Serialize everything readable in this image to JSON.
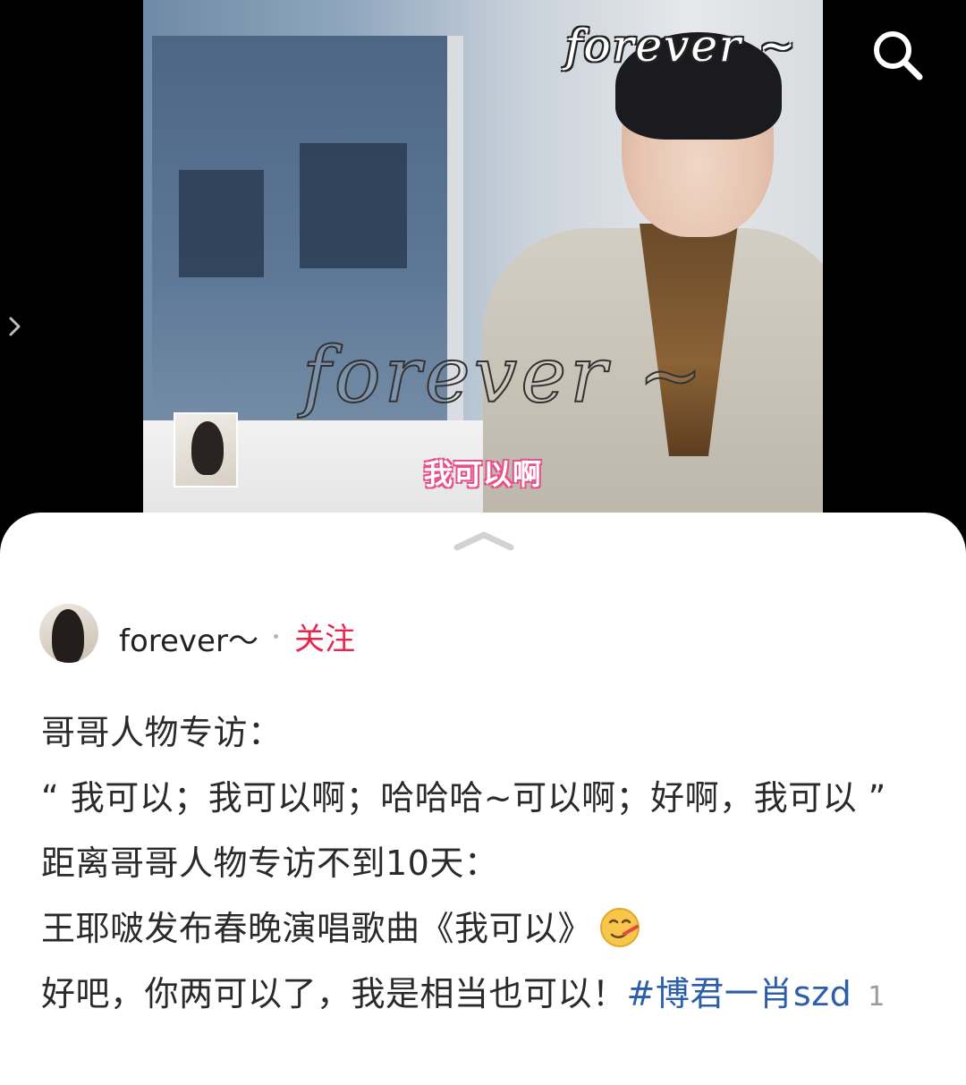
{
  "video": {
    "watermark_top": "forever ~",
    "watermark_center": "forever ~",
    "subtitle": "我可以啊"
  },
  "icons": {
    "search": "search-icon",
    "side_nav": "chevron-right-icon",
    "sheet_handle": "chevron-up-icon",
    "emoji": "sick-face-emoji"
  },
  "author": {
    "name": "forever～",
    "follow_label": "关注"
  },
  "post": {
    "lines": [
      "哥哥人物专访：",
      "“ 我可以；我可以啊；哈哈哈~可以啊；好啊，我可以 ”",
      "距离哥哥人物专访不到10天：",
      "王耶啵发布春晚演唱歌曲《我可以》",
      "好吧，你两可以了，我是相当也可以！"
    ],
    "hashtag": "#博君一肖szd",
    "trailing_count": "1"
  },
  "colors": {
    "follow": "#e6264f",
    "hashtag": "#2d5ea8",
    "subtitle_stroke": "#e8508a"
  }
}
